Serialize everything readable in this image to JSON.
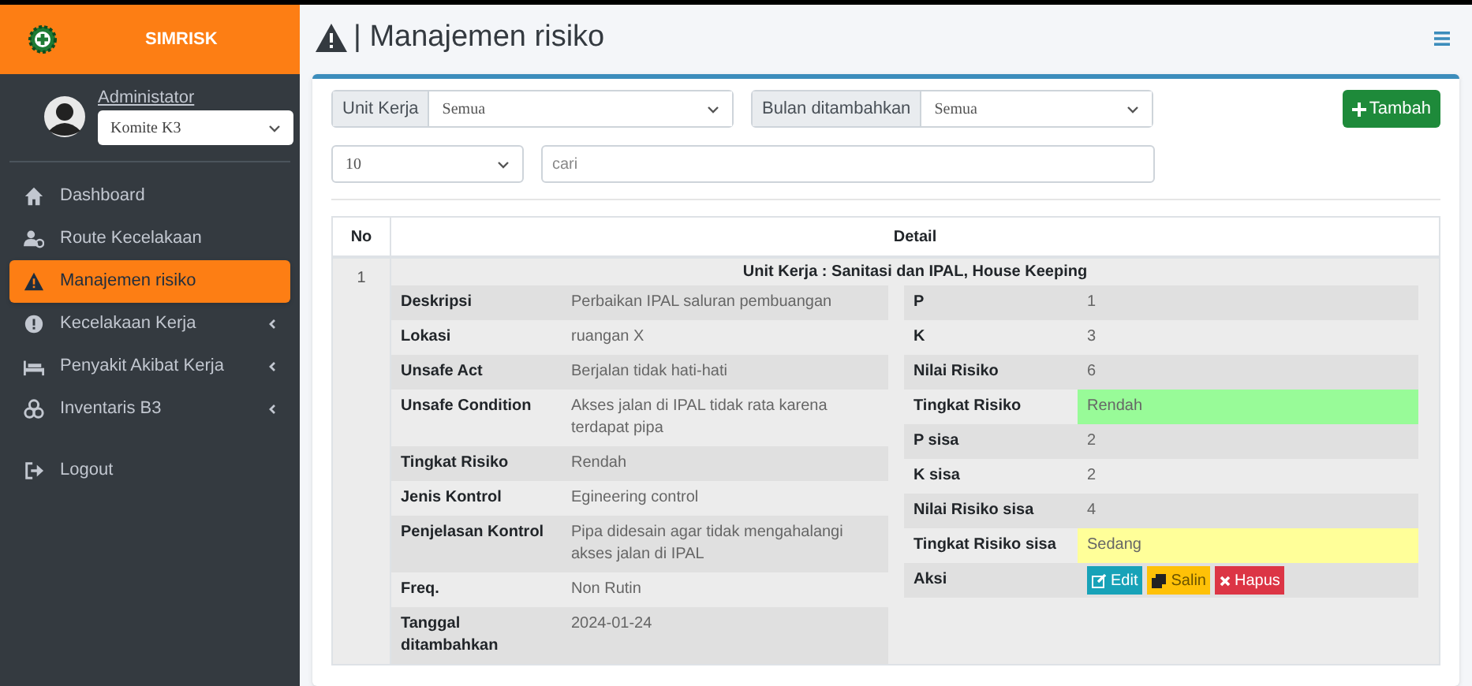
{
  "brand": "SIMRISK",
  "user": {
    "name": "Administator",
    "unit": "Komite K3"
  },
  "sidebar": {
    "items": [
      {
        "label": "Dashboard",
        "selected": false,
        "has_submenu": false
      },
      {
        "label": "Route Kecelakaan",
        "selected": false,
        "has_submenu": false
      },
      {
        "label": "Manajemen risiko",
        "selected": true,
        "has_submenu": false
      },
      {
        "label": "Kecelakaan Kerja",
        "selected": false,
        "has_submenu": true
      },
      {
        "label": "Penyakit Akibat Kerja",
        "selected": false,
        "has_submenu": true
      },
      {
        "label": "Inventaris B3",
        "selected": false,
        "has_submenu": true
      },
      {
        "label": "Logout",
        "selected": false,
        "has_submenu": false
      }
    ]
  },
  "page_title": "| Manajemen risiko",
  "filters": {
    "unit_label": "Unit Kerja",
    "unit_value": "Semua",
    "month_label": "Bulan ditambahkan",
    "month_value": "Semua",
    "add_button": "Tambah",
    "page_size": "10",
    "search_placeholder": "cari"
  },
  "table": {
    "columns": [
      "No",
      "Detail"
    ],
    "rows": [
      {
        "no": "1",
        "unit": "Unit Kerja : Sanitasi dan IPAL, House Keeping",
        "left": [
          {
            "label": "Deskripsi",
            "value": "Perbaikan IPAL saluran pembuangan"
          },
          {
            "label": "Lokasi",
            "value": "ruangan X"
          },
          {
            "label": "Unsafe Act",
            "value": "Berjalan tidak hati-hati"
          },
          {
            "label": "Unsafe Condition",
            "value": "Akses jalan di IPAL tidak rata karena terdapat pipa"
          },
          {
            "label": "Tingkat Risiko",
            "value": "Rendah"
          },
          {
            "label": "Jenis Kontrol",
            "value": "Egineering control"
          },
          {
            "label": "Penjelasan Kontrol",
            "value": "Pipa didesain agar tidak mengahalangi akses jalan di IPAL"
          },
          {
            "label": "Freq.",
            "value": "Non Rutin"
          },
          {
            "label": "Tanggal ditambahkan",
            "value": "2024-01-24"
          }
        ],
        "right": [
          {
            "kind": "text",
            "label": "P",
            "value": "1"
          },
          {
            "kind": "text",
            "label": "K",
            "value": "3"
          },
          {
            "kind": "text",
            "label": "Nilai Risiko",
            "value": "6"
          },
          {
            "kind": "text",
            "label": "Tingkat Risiko",
            "value": "Rendah",
            "color": "#98fb98"
          },
          {
            "kind": "text",
            "label": "P sisa",
            "value": "2"
          },
          {
            "kind": "text",
            "label": "K sisa",
            "value": "2"
          },
          {
            "kind": "text",
            "label": "Nilai Risiko sisa",
            "value": "4"
          },
          {
            "kind": "text",
            "label": "Tingkat Risiko sisa",
            "value": "Sedang",
            "color": "#ffff99"
          },
          {
            "kind": "actions",
            "label": "Aksi",
            "buttons": [
              "Edit",
              "Salin",
              "Hapus"
            ]
          }
        ]
      }
    ]
  }
}
